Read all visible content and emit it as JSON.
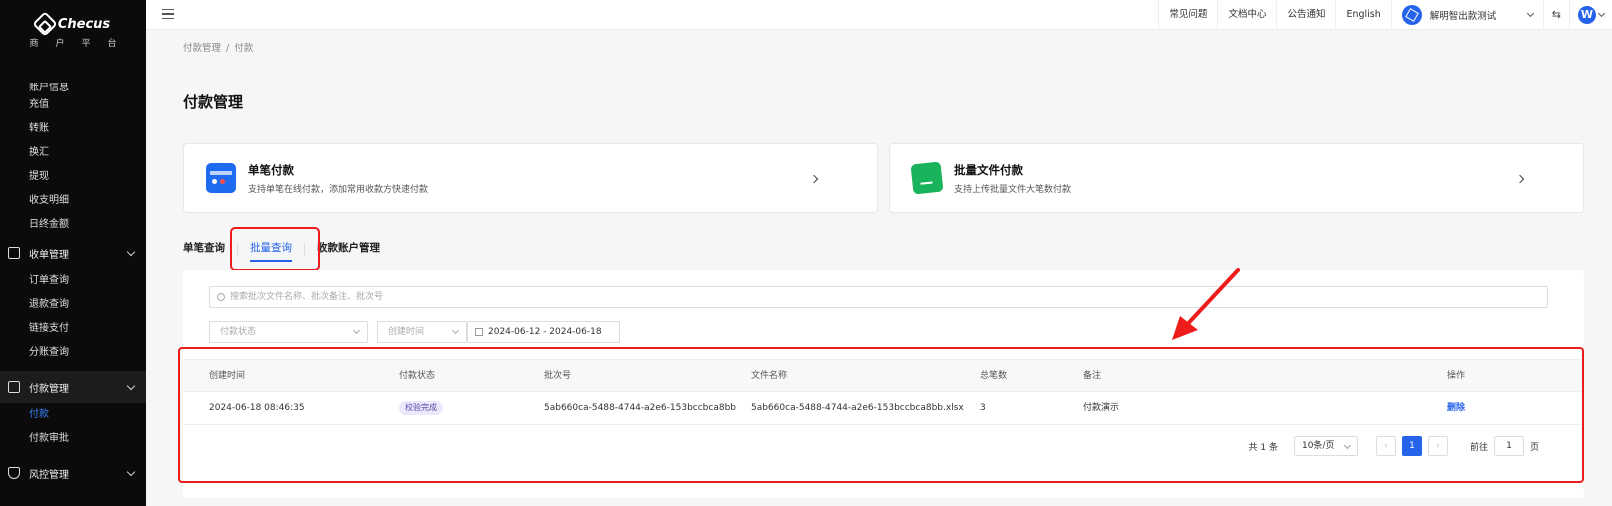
{
  "brand": {
    "name": "Checus",
    "subtitle": "商户平台"
  },
  "sidebar": {
    "partial_item": "账户信息",
    "account_items": [
      "充值",
      "转账",
      "换汇",
      "提现",
      "收支明细",
      "日终金额"
    ],
    "groups": [
      {
        "label": "收单管理",
        "icon": "receipt-icon",
        "items": [
          "订单查询",
          "退款查询",
          "链接支付",
          "分账查询"
        ]
      },
      {
        "label": "付款管理",
        "icon": "transfer-icon",
        "items": [
          "付款",
          "付款审批"
        ],
        "active_item": "付款"
      },
      {
        "label": "风控管理",
        "icon": "shield-icon",
        "items": []
      }
    ]
  },
  "topbar": {
    "links": [
      "常见问题",
      "文档中心",
      "公告通知",
      "English"
    ],
    "user_name": "解明智出款测试",
    "swap_symbol": "⇆",
    "avatar_letter": "W"
  },
  "breadcrumb": {
    "parent": "付款管理",
    "separator": "/",
    "current": "付款"
  },
  "page_title": "付款管理",
  "cards": [
    {
      "title": "单笔付款",
      "desc": "支持单笔在线付款，添加常用收款方快速付款",
      "icon": "card-icon"
    },
    {
      "title": "批量文件付款",
      "desc": "支持上传批量文件大笔数付款",
      "icon": "file-icon"
    }
  ],
  "tabs": [
    "单笔查询",
    "批量查询",
    "收款账户管理"
  ],
  "active_tab": "批量查询",
  "search_placeholder": "搜索批次文件名称、批次备注、批次号",
  "filters": {
    "status_placeholder": "付款状态",
    "time_placeholder": "创建时间",
    "date_range": "2024-06-12  -  2024-06-18"
  },
  "table": {
    "headers": [
      "创建时间",
      "付款状态",
      "批次号",
      "文件名称",
      "总笔数",
      "备注",
      "操作"
    ],
    "rows": [
      {
        "created": "2024-06-18 08:46:35",
        "status": "校验完成",
        "batch_no": "5ab660ca-5488-4744-a2e6-153bccbca8bb",
        "file_name": "5ab660ca-5488-4744-a2e6-153bccbca8bb.xlsx",
        "count": "3",
        "remark": "付款演示",
        "action": "删除"
      }
    ]
  },
  "pagination": {
    "total": "共 1 条",
    "page_size": "10条/页",
    "prev": "‹",
    "current": "1",
    "next": "›",
    "goto_label": "前往",
    "goto_value": "1",
    "page_unit": "页"
  },
  "colors": {
    "accent": "#2563eb",
    "highlight": "#ef1c1c",
    "sidebar_bg": "#0b0b0b"
  }
}
